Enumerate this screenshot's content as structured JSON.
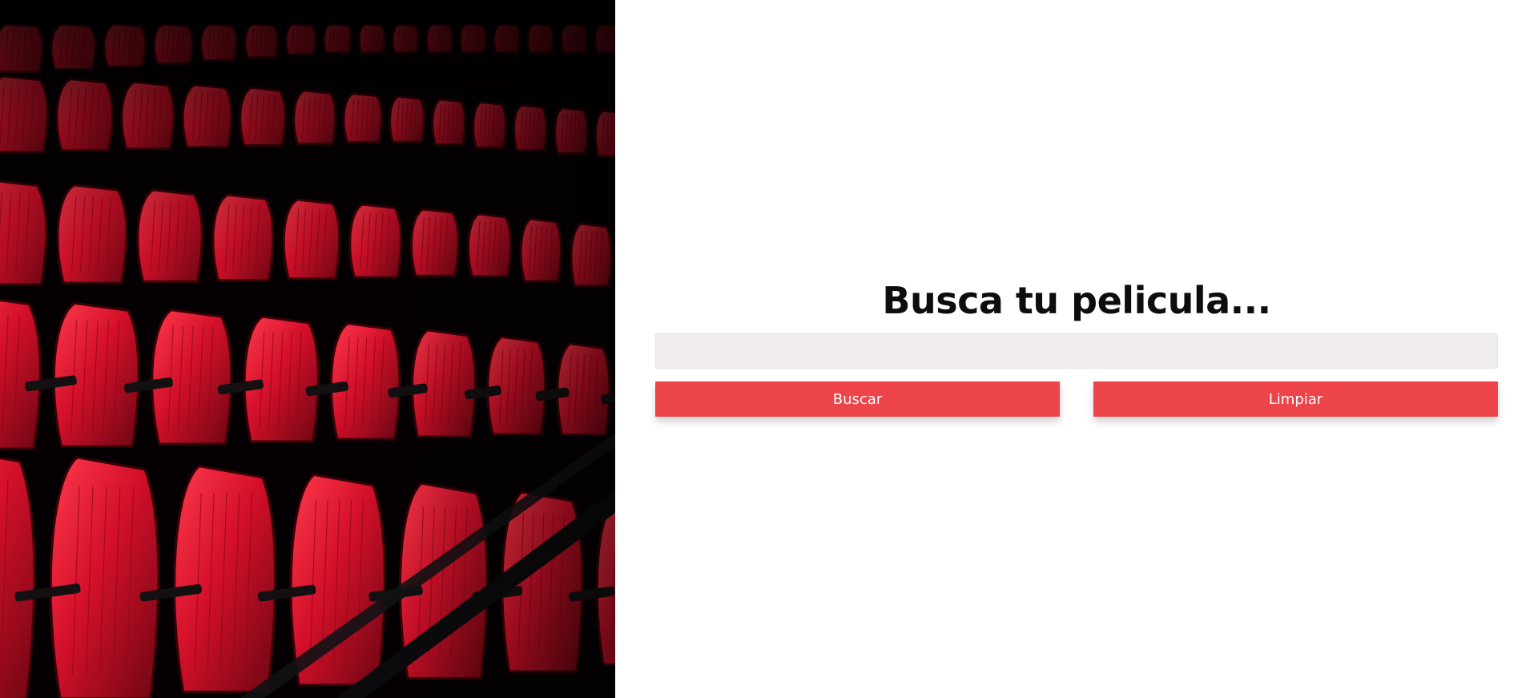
{
  "hero": {
    "image_icon": "theater-seats-photo",
    "seat_color": "#c90f23",
    "background_color": "#050102"
  },
  "search": {
    "title": "Busca tu pelicula...",
    "input_value": "",
    "input_placeholder": "",
    "buttons": {
      "search_label": "Buscar",
      "clear_label": "Limpiar"
    },
    "accent_color": "#ec4448",
    "input_background": "#f3eeee"
  }
}
